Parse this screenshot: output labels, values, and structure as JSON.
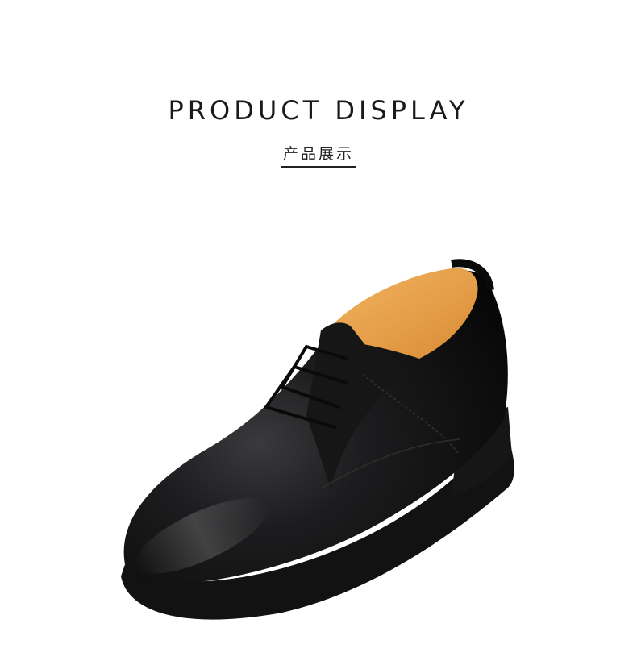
{
  "header": {
    "title": "PRODUCT DISPLAY",
    "subtitle": "产品展示"
  },
  "product": {
    "image": "black-leather-derby-shoe",
    "colors": {
      "leather": "#0f0f10",
      "lining": "#e9a24c",
      "sole": "#141414",
      "background": "#ffffff"
    }
  }
}
